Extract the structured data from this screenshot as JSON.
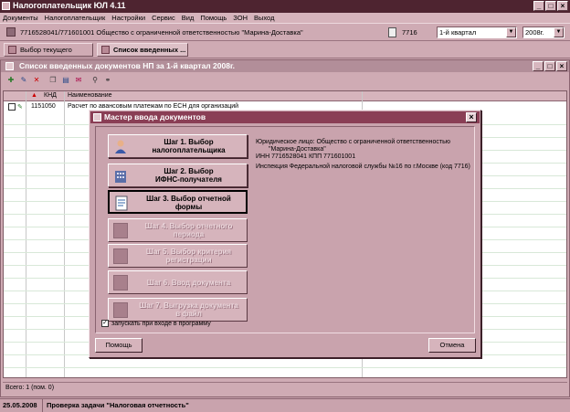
{
  "app": {
    "title": "Налогоплательщик ЮЛ 4.11"
  },
  "menu": [
    "Документы",
    "Налогоплательщик",
    "Настройки",
    "Сервис",
    "Вид",
    "Помощь",
    "ЗОН",
    "Выход"
  ],
  "infobar": {
    "org": "7716528041/771601001 Общество с ограниченной ответственностью \"Марина-Доставка\"",
    "code": "7716",
    "period": "1-й квартал",
    "year": "2008г."
  },
  "tabs": [
    {
      "label": "Выбор текущего плател..."
    },
    {
      "label": "Список введенных ..."
    }
  ],
  "doc_window": {
    "title": "Список введенных документов НП за 1-й квартал 2008г.",
    "columns": [
      "КНД",
      "Наименование"
    ],
    "rows": [
      {
        "knd": "1151050",
        "name": "Расчет по авансовым платежам по ЕСН для организаций"
      }
    ],
    "status": "Всего: 1 (пом. 0)"
  },
  "statusbar": {
    "date": "25.05.2008",
    "task": "Проверка задачи \"Налоговая отчетность\""
  },
  "dialog": {
    "title": "Мастер ввода документов",
    "steps": [
      {
        "line1": "Шаг 1. Выбор",
        "line2": "налогоплательщика",
        "icon": "taxpayer-icon"
      },
      {
        "line1": "Шаг 2. Выбор",
        "line2": "ИФНС-получателя",
        "icon": "building-icon"
      },
      {
        "line1": "Шаг 3. Выбор отчетной",
        "line2": "формы",
        "icon": "form-icon"
      },
      {
        "line1": "Шаг 4. Выбор отчетного",
        "line2": "периода",
        "icon": "period-icon"
      },
      {
        "line1": "Шаг 5. Выбор критерия",
        "line2": "регистрации",
        "icon": "criteria-icon"
      },
      {
        "line1": "Шаг 6. Ввод документа",
        "line2": "",
        "icon": "document-icon"
      },
      {
        "line1": "Шаг 7. Выгрузка документа",
        "line2": "в файл",
        "icon": "export-icon"
      }
    ],
    "info": {
      "org_line1": "Юридическое лицо: Общество с ограниченной ответственностью",
      "org_line2": "\"Марина-Доставка\"",
      "inn_kpp": "ИНН 7716528041   КПП 771601001",
      "ifns": "Инспекция Федеральной налоговой службы №16 по г.Москве (код 7716)"
    },
    "checkbox_label": "запускать при входе в программу",
    "help_label": "Помощь",
    "cancel_label": "Отмена"
  }
}
